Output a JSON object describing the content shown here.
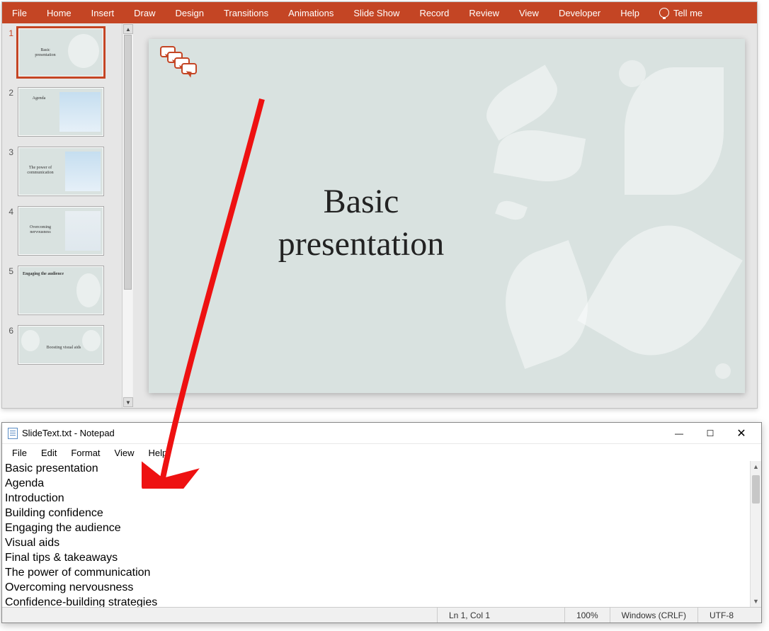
{
  "powerpoint": {
    "ribbon": [
      "File",
      "Home",
      "Insert",
      "Draw",
      "Design",
      "Transitions",
      "Animations",
      "Slide Show",
      "Record",
      "Review",
      "View",
      "Developer",
      "Help"
    ],
    "tellme": "Tell me",
    "slide_title_line1": "Basic",
    "slide_title_line2": "presentation",
    "thumbs": {
      "1": "Basic presentation",
      "2": "Agenda",
      "3": "The power of communication",
      "4": "Overcoming nervousness",
      "5": "Engaging the audience",
      "6": "Boosting visual aids"
    }
  },
  "notepad": {
    "title": "SlideText.txt - Notepad",
    "menu": [
      "File",
      "Edit",
      "Format",
      "View",
      "Help"
    ],
    "lines": [
      "Basic presentation",
      "Agenda",
      "Introduction",
      "Building confidence",
      "Engaging the audience",
      "Visual aids",
      "Final tips & takeaways",
      "The power of communication",
      "Overcoming nervousness",
      "Confidence-building strategies"
    ],
    "status": {
      "pos": "Ln 1, Col 1",
      "zoom": "100%",
      "eol": "Windows (CRLF)",
      "enc": "UTF-8"
    },
    "controls": {
      "min": "—",
      "max": "☐",
      "close": "✕"
    }
  }
}
